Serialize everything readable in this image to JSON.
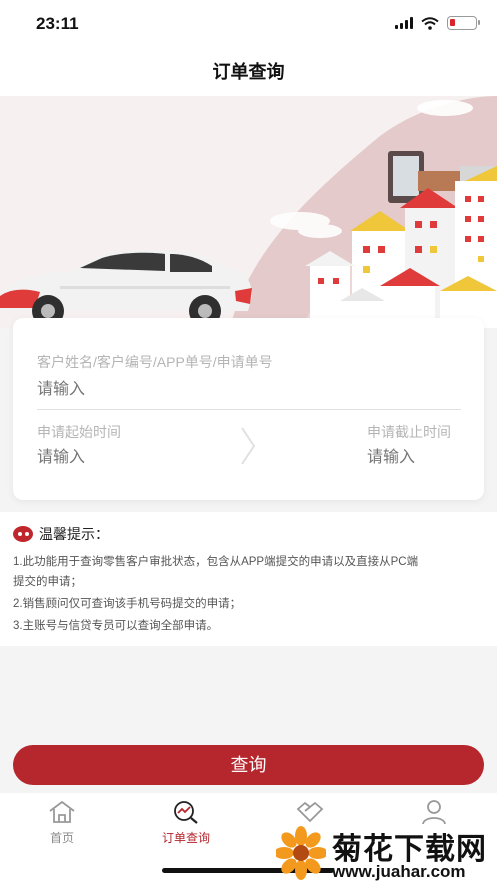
{
  "status": {
    "time": "23:11"
  },
  "header": {
    "title": "订单查询"
  },
  "search": {
    "keyword_label": "客户姓名/客户编号/APP单号/申请单号",
    "keyword_placeholder": "请输入",
    "start_label": "申请起始时间",
    "start_placeholder": "请输入",
    "end_label": "申请截止时间",
    "end_placeholder": "请输入"
  },
  "tips": {
    "title": "温馨提示：",
    "lines": [
      "1.此功能用于查询零售客户审批状态，包含从APP端提交的申请以及直接从PC端",
      "提交的申请；",
      "2.销售顾问仅可查询该手机号码提交的申请；",
      "3.主账号与信贷专员可以查询全部申请。"
    ]
  },
  "query_button": "查询",
  "tabs": [
    {
      "label": "首页",
      "icon": "home-icon",
      "active": false
    },
    {
      "label": "订单查询",
      "icon": "order-search-icon",
      "active": true
    },
    {
      "label": "",
      "icon": "handshake-icon",
      "active": false
    },
    {
      "label": "",
      "icon": "user-icon",
      "active": false
    }
  ],
  "watermark": {
    "title": "菊花下载网",
    "url": "www.juahar.com"
  },
  "colors": {
    "accent": "#b5272d",
    "background": "#f4f4f4"
  }
}
